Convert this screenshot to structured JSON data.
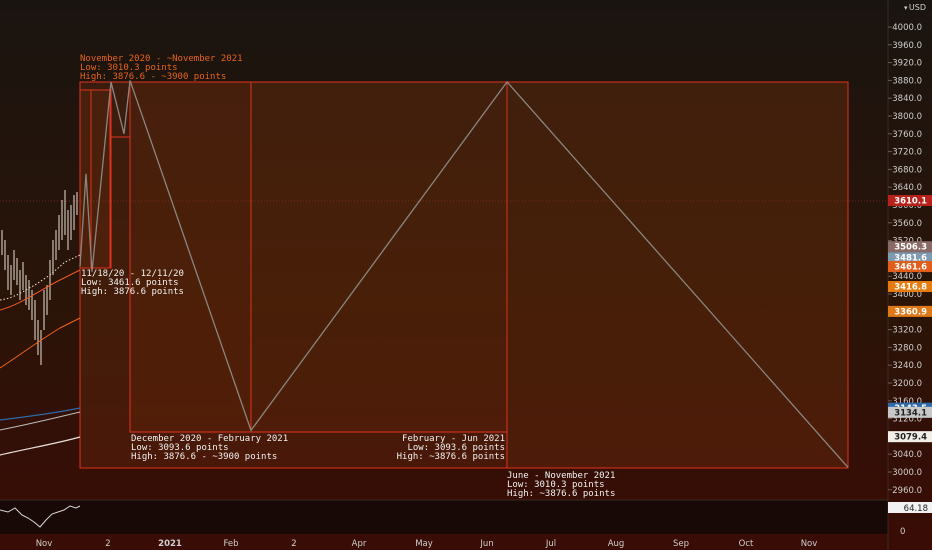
{
  "currency": "USD",
  "price_axis": {
    "ticks": [
      "4000.0",
      "3960.0",
      "3920.0",
      "3880.0",
      "3840.0",
      "3800.0",
      "3760.0",
      "3720.0",
      "3680.0",
      "3640.0",
      "3600.0",
      "3560.0",
      "3520.0",
      "3480.0",
      "3440.0",
      "3400.0",
      "3360.0",
      "3320.0",
      "3280.0",
      "3240.0",
      "3200.0",
      "3160.0",
      "3120.0",
      "3080.0",
      "3040.0",
      "3000.0",
      "2960.0"
    ],
    "tick_values": [
      4000,
      3960,
      3920,
      3880,
      3840,
      3800,
      3760,
      3720,
      3680,
      3640,
      3600,
      3560,
      3520,
      3480,
      3440,
      3400,
      3360,
      3320,
      3280,
      3240,
      3200,
      3160,
      3120,
      3080,
      3040,
      3000,
      2960
    ]
  },
  "price_labels": [
    {
      "text": "3610.1",
      "value": 3610.1,
      "color": "#b7221a"
    },
    {
      "text": "3506.3",
      "value": 3506.3,
      "color": "#8a6a66"
    },
    {
      "text": "3481.6",
      "value": 3481.6,
      "color": "#7e9aae"
    },
    {
      "text": "3461.6",
      "value": 3461.6,
      "color": "#e25c1a"
    },
    {
      "text": "3416.8",
      "value": 3416.8,
      "color": "#e67c10"
    },
    {
      "text": "3360.9",
      "value": 3360.9,
      "color": "#e07818"
    },
    {
      "text": "3143.5",
      "value": 3143.5,
      "color": "#2e6aa8"
    },
    {
      "text": "3134.1",
      "value": 3134.1,
      "color": "#c8c8c8"
    },
    {
      "text": "3079.4",
      "value": 3079.4,
      "color": "#f2efe8"
    }
  ],
  "oscillator": {
    "value_label": "64.18",
    "zero_label": "0"
  },
  "time_axis": {
    "labels": [
      "Nov",
      "2",
      "2021",
      "Feb",
      "2",
      "Apr",
      "May",
      "Jun",
      "Jul",
      "Aug",
      "Sep",
      "Oct",
      "Nov"
    ]
  },
  "annotations": {
    "main": {
      "l1": "November 2020 - ~November 2021",
      "l2": "Low: 3010.3 points",
      "l3": "High: 3876.6 - ~3900 points"
    },
    "wave1": {
      "l1": "11/18/20 - 12/11/20",
      "l2": "Low: 3461.6 points",
      "l3": "High: 3876.6 points"
    },
    "wave2": {
      "l1": "December 2020 - February 2021",
      "l2": "Low: 3093.6 points",
      "l3": "High: 3876.6 - ~3900 points"
    },
    "wave3": {
      "l1": "February - Jun 2021",
      "l2": "Low: 3093.6 points",
      "l3": "High: ~3876.6 points"
    },
    "wave4": {
      "l1": "June - November 2021",
      "l2": "Low: 3010.3 points",
      "l3": "High: ~3876.6 points"
    }
  },
  "chart_data": {
    "type": "line",
    "title": "",
    "xlabel": "",
    "ylabel": "",
    "ylim": [
      2940,
      4020
    ],
    "series": [
      {
        "points": [
          {
            "x": "11/18/20",
            "y": 3461.6
          },
          {
            "x": "11/26/20",
            "y": 3670
          },
          {
            "x": "12/02/20",
            "y": 3450
          },
          {
            "x": "12/11/20",
            "y": 3876.6
          },
          {
            "x": "12/20/20",
            "y": 3760
          },
          {
            "x": "12/28/20",
            "y": 3880
          },
          {
            "x": "Feb 2021",
            "y": 3093.6
          },
          {
            "x": "Jun 2021",
            "y": 3876.6
          },
          {
            "x": "Nov 2021",
            "y": 3010.3
          }
        ]
      }
    ]
  }
}
